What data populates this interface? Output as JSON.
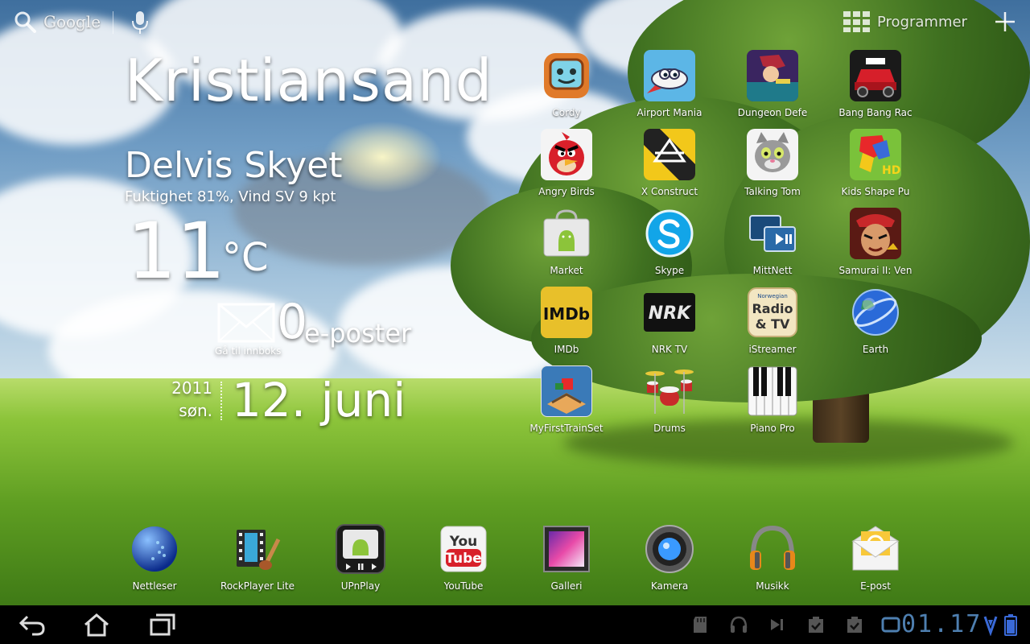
{
  "topbar": {
    "search_label": "Google",
    "search_icon": "search-icon",
    "voice_icon": "microphone-icon",
    "apps_label": "Programmer",
    "apps_icon": "grid-icon",
    "add_icon": "plus-icon"
  },
  "weather": {
    "city": "Kristiansand",
    "condition": "Delvis Skyet",
    "details": "Fuktighet 81%, Vind SV 9 kpt",
    "temperature": "11",
    "unit": "°C"
  },
  "mail": {
    "count": "0",
    "label": "e-poster",
    "goto": "Gå til innboks",
    "icon": "envelope-icon"
  },
  "date": {
    "year": "2011",
    "weekday": "søn.",
    "day_month": "12. juni"
  },
  "apps": [
    {
      "label": "Cordy",
      "icon": "cordy-robot-icon"
    },
    {
      "label": "Airport Mania",
      "icon": "airplane-icon"
    },
    {
      "label": "Dungeon Defe",
      "icon": "dungeon-defenders-icon"
    },
    {
      "label": "Bang Bang Rac",
      "icon": "race-car-icon"
    },
    {
      "label": "Angry Birds",
      "icon": "angry-bird-icon"
    },
    {
      "label": "X Construct",
      "icon": "x-construct-icon"
    },
    {
      "label": "Talking Tom",
      "icon": "cat-icon"
    },
    {
      "label": "Kids Shape Pu",
      "icon": "shape-puzzle-icon"
    },
    {
      "label": "Market",
      "icon": "market-bag-icon"
    },
    {
      "label": "Skype",
      "icon": "skype-icon"
    },
    {
      "label": "MittNett",
      "icon": "network-screens-icon"
    },
    {
      "label": "Samurai II: Ven",
      "icon": "samurai-icon"
    },
    {
      "label": "IMDb",
      "icon": "imdb-icon"
    },
    {
      "label": "NRK TV",
      "icon": "nrk-icon"
    },
    {
      "label": "iStreamer",
      "icon": "radio-tv-icon"
    },
    {
      "label": "Earth",
      "icon": "globe-icon"
    },
    {
      "label": "MyFirstTrainSet",
      "icon": "train-set-icon"
    },
    {
      "label": "Drums",
      "icon": "drums-icon"
    },
    {
      "label": "Piano Pro",
      "icon": "piano-icon"
    }
  ],
  "app_icon_text": {
    "imdb": "IMDb",
    "nrk": "NRK",
    "istreamer_top": "Norwegian",
    "istreamer_mid": "Radio",
    "istreamer_bot": "& TV",
    "kids_hd": "HD",
    "youtube_you": "You",
    "youtube_tube": "Tube"
  },
  "dock": [
    {
      "label": "Nettleser",
      "icon": "browser-globe-icon"
    },
    {
      "label": "RockPlayer Lite",
      "icon": "film-guitar-icon"
    },
    {
      "label": "UPnPlay",
      "icon": "android-player-icon"
    },
    {
      "label": "YouTube",
      "icon": "youtube-icon"
    },
    {
      "label": "Galleri",
      "icon": "gallery-icon"
    },
    {
      "label": "Kamera",
      "icon": "camera-lens-icon"
    },
    {
      "label": "Musikk",
      "icon": "headphones-icon"
    },
    {
      "label": "E-post",
      "icon": "email-envelope-icon"
    }
  ],
  "sysbar": {
    "back_icon": "back-icon",
    "home_icon": "home-icon",
    "recent_icon": "recent-apps-icon",
    "clock": "01.17",
    "status_icons": [
      "sd-card-icon",
      "headset-icon",
      "media-next-icon",
      "task-done-icon",
      "task-done-icon",
      "battery-icon"
    ]
  },
  "colors": {
    "clock": "#4e7fb0",
    "sysbar_bg": "#000000"
  }
}
